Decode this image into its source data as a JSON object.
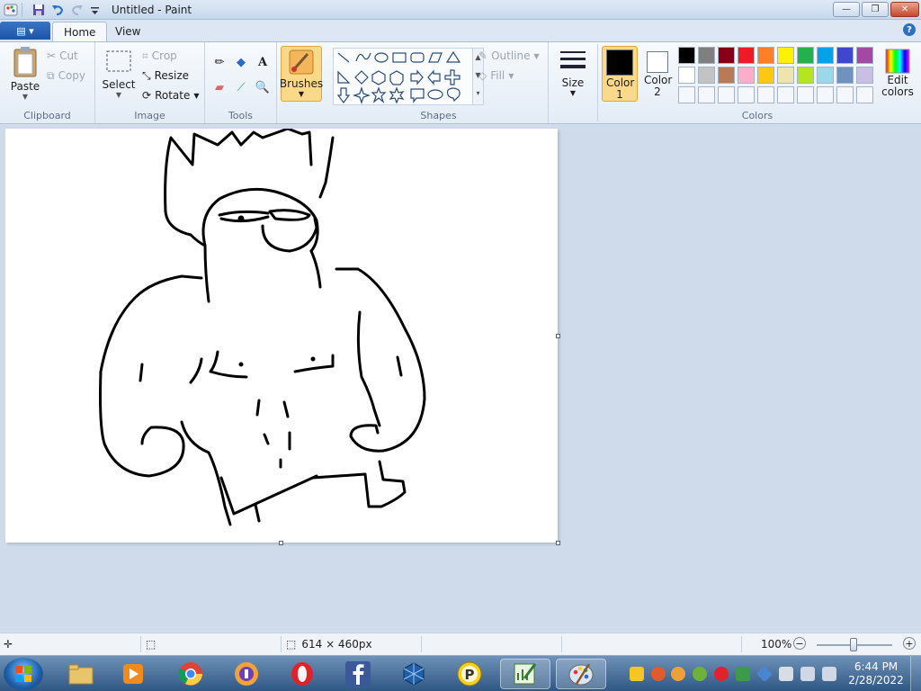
{
  "window": {
    "title": "Untitled - Paint",
    "minimize_label": "—",
    "restore_label": "❐",
    "close_label": "✕"
  },
  "ribbon_tabs": {
    "file_label": "▤ ▾",
    "home": "Home",
    "view": "View",
    "help": "?"
  },
  "clipboard": {
    "paste": "Paste",
    "cut": "Cut",
    "copy": "Copy",
    "group_label": "Clipboard"
  },
  "image": {
    "select": "Select",
    "crop": "Crop",
    "resize": "Resize",
    "rotate": "Rotate",
    "group_label": "Image"
  },
  "tools": {
    "group_label": "Tools"
  },
  "brushes": {
    "label": "Brushes"
  },
  "shapes": {
    "outline": "Outline",
    "fill": "Fill",
    "group_label": "Shapes"
  },
  "size": {
    "label": "Size"
  },
  "colors": {
    "color1_label": "Color 1",
    "color2_label": "Color 2",
    "edit_colors": "Edit colors",
    "group_label": "Colors",
    "color1_value": "#000000",
    "color2_value": "#ffffff",
    "palette_row1": [
      "#000000",
      "#7f7f7f",
      "#880015",
      "#ed1c24",
      "#ff7f27",
      "#fff200",
      "#22b14c",
      "#00a2e8",
      "#3f48cc",
      "#a349a4"
    ],
    "palette_row2": [
      "#ffffff",
      "#c3c3c3",
      "#b97a57",
      "#ffaec9",
      "#ffc90e",
      "#efe4b0",
      "#b5e61d",
      "#99d9ea",
      "#7092be",
      "#c8bfe7"
    ],
    "palette_row3": [
      "#f4f7fb",
      "#f4f7fb",
      "#f4f7fb",
      "#f4f7fb",
      "#f4f7fb",
      "#f4f7fb",
      "#f4f7fb",
      "#f4f7fb",
      "#f4f7fb",
      "#f4f7fb"
    ]
  },
  "statusbar": {
    "canvas_size": "614 × 460px",
    "zoom": "100%"
  },
  "taskbar": {
    "time": "6:44 PM",
    "date": "2/28/2022"
  }
}
